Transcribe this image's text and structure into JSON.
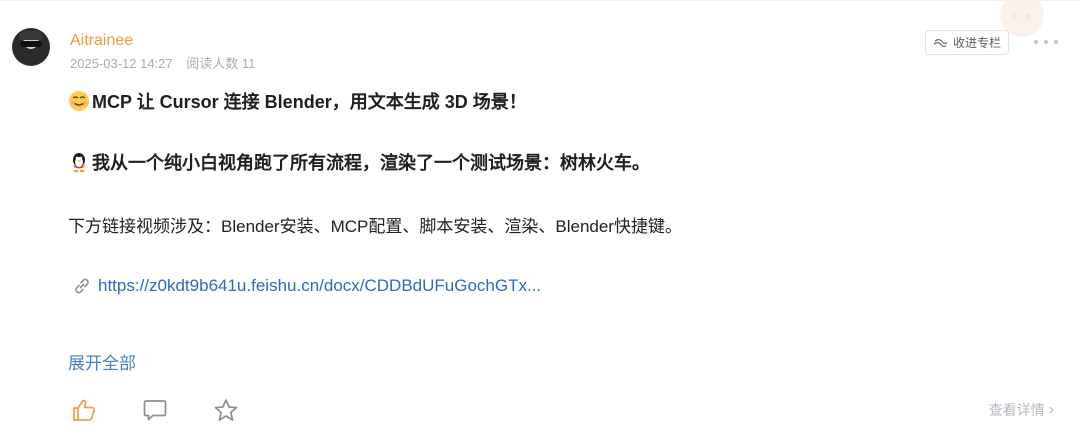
{
  "post": {
    "author": "Aitrainee",
    "date": "2025-03-12 14:27",
    "reads": "阅读人数 11",
    "collect_label": "收进专栏",
    "line1": "MCP 让 Cursor 连接 Blender，用文本生成 3D 场景！",
    "line2": "我从一个纯小白视角跑了所有流程，渲染了一个测试场景：树林火车。",
    "line3": "下方链接视频涉及：Blender安装、MCP配置、脚本安装、渲染、Blender快捷键。",
    "link_text": "https://z0kdt9b641u.feishu.cn/docx/CDDBdUFuGochGTx...",
    "expand_label": "展开全部",
    "detail_label": "查看详情"
  },
  "icons": {
    "line1_emoji": "smiling-face-emoji-icon",
    "line2_emoji": "penguin-emoji-icon",
    "link": "link-icon",
    "like": "thumbs-up-icon",
    "comment": "comment-icon",
    "favorite": "star-icon",
    "collect": "collection-icon",
    "more": "more-dots-icon",
    "detail": "chevron-right-icon"
  },
  "colors": {
    "author": "#f29a3a",
    "link": "#2e69c5",
    "expand": "#4c7fc9",
    "meta": "#a8adb5"
  }
}
